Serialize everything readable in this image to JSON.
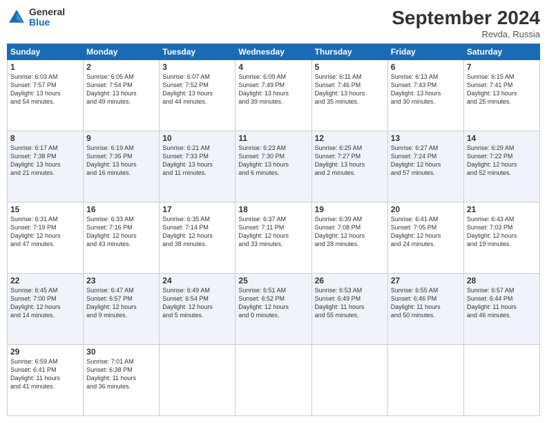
{
  "header": {
    "logo_general": "General",
    "logo_blue": "Blue",
    "title": "September 2024",
    "location": "Revda, Russia"
  },
  "weekdays": [
    "Sunday",
    "Monday",
    "Tuesday",
    "Wednesday",
    "Thursday",
    "Friday",
    "Saturday"
  ],
  "weeks": [
    [
      {
        "day": "1",
        "lines": [
          "Sunrise: 6:03 AM",
          "Sunset: 7:57 PM",
          "Daylight: 13 hours",
          "and 54 minutes."
        ]
      },
      {
        "day": "2",
        "lines": [
          "Sunrise: 6:05 AM",
          "Sunset: 7:54 PM",
          "Daylight: 13 hours",
          "and 49 minutes."
        ]
      },
      {
        "day": "3",
        "lines": [
          "Sunrise: 6:07 AM",
          "Sunset: 7:52 PM",
          "Daylight: 13 hours",
          "and 44 minutes."
        ]
      },
      {
        "day": "4",
        "lines": [
          "Sunrise: 6:09 AM",
          "Sunset: 7:49 PM",
          "Daylight: 13 hours",
          "and 39 minutes."
        ]
      },
      {
        "day": "5",
        "lines": [
          "Sunrise: 6:11 AM",
          "Sunset: 7:46 PM",
          "Daylight: 13 hours",
          "and 35 minutes."
        ]
      },
      {
        "day": "6",
        "lines": [
          "Sunrise: 6:13 AM",
          "Sunset: 7:43 PM",
          "Daylight: 13 hours",
          "and 30 minutes."
        ]
      },
      {
        "day": "7",
        "lines": [
          "Sunrise: 6:15 AM",
          "Sunset: 7:41 PM",
          "Daylight: 13 hours",
          "and 25 minutes."
        ]
      }
    ],
    [
      {
        "day": "8",
        "lines": [
          "Sunrise: 6:17 AM",
          "Sunset: 7:38 PM",
          "Daylight: 13 hours",
          "and 21 minutes."
        ]
      },
      {
        "day": "9",
        "lines": [
          "Sunrise: 6:19 AM",
          "Sunset: 7:35 PM",
          "Daylight: 13 hours",
          "and 16 minutes."
        ]
      },
      {
        "day": "10",
        "lines": [
          "Sunrise: 6:21 AM",
          "Sunset: 7:33 PM",
          "Daylight: 13 hours",
          "and 11 minutes."
        ]
      },
      {
        "day": "11",
        "lines": [
          "Sunrise: 6:23 AM",
          "Sunset: 7:30 PM",
          "Daylight: 13 hours",
          "and 6 minutes."
        ]
      },
      {
        "day": "12",
        "lines": [
          "Sunrise: 6:25 AM",
          "Sunset: 7:27 PM",
          "Daylight: 13 hours",
          "and 2 minutes."
        ]
      },
      {
        "day": "13",
        "lines": [
          "Sunrise: 6:27 AM",
          "Sunset: 7:24 PM",
          "Daylight: 12 hours",
          "and 57 minutes."
        ]
      },
      {
        "day": "14",
        "lines": [
          "Sunrise: 6:29 AM",
          "Sunset: 7:22 PM",
          "Daylight: 12 hours",
          "and 52 minutes."
        ]
      }
    ],
    [
      {
        "day": "15",
        "lines": [
          "Sunrise: 6:31 AM",
          "Sunset: 7:19 PM",
          "Daylight: 12 hours",
          "and 47 minutes."
        ]
      },
      {
        "day": "16",
        "lines": [
          "Sunrise: 6:33 AM",
          "Sunset: 7:16 PM",
          "Daylight: 12 hours",
          "and 43 minutes."
        ]
      },
      {
        "day": "17",
        "lines": [
          "Sunrise: 6:35 AM",
          "Sunset: 7:14 PM",
          "Daylight: 12 hours",
          "and 38 minutes."
        ]
      },
      {
        "day": "18",
        "lines": [
          "Sunrise: 6:37 AM",
          "Sunset: 7:11 PM",
          "Daylight: 12 hours",
          "and 33 minutes."
        ]
      },
      {
        "day": "19",
        "lines": [
          "Sunrise: 6:39 AM",
          "Sunset: 7:08 PM",
          "Daylight: 12 hours",
          "and 28 minutes."
        ]
      },
      {
        "day": "20",
        "lines": [
          "Sunrise: 6:41 AM",
          "Sunset: 7:05 PM",
          "Daylight: 12 hours",
          "and 24 minutes."
        ]
      },
      {
        "day": "21",
        "lines": [
          "Sunrise: 6:43 AM",
          "Sunset: 7:03 PM",
          "Daylight: 12 hours",
          "and 19 minutes."
        ]
      }
    ],
    [
      {
        "day": "22",
        "lines": [
          "Sunrise: 6:45 AM",
          "Sunset: 7:00 PM",
          "Daylight: 12 hours",
          "and 14 minutes."
        ]
      },
      {
        "day": "23",
        "lines": [
          "Sunrise: 6:47 AM",
          "Sunset: 6:57 PM",
          "Daylight: 12 hours",
          "and 9 minutes."
        ]
      },
      {
        "day": "24",
        "lines": [
          "Sunrise: 6:49 AM",
          "Sunset: 6:54 PM",
          "Daylight: 12 hours",
          "and 5 minutes."
        ]
      },
      {
        "day": "25",
        "lines": [
          "Sunrise: 6:51 AM",
          "Sunset: 6:52 PM",
          "Daylight: 12 hours",
          "and 0 minutes."
        ]
      },
      {
        "day": "26",
        "lines": [
          "Sunrise: 6:53 AM",
          "Sunset: 6:49 PM",
          "Daylight: 11 hours",
          "and 55 minutes."
        ]
      },
      {
        "day": "27",
        "lines": [
          "Sunrise: 6:55 AM",
          "Sunset: 6:46 PM",
          "Daylight: 11 hours",
          "and 50 minutes."
        ]
      },
      {
        "day": "28",
        "lines": [
          "Sunrise: 6:57 AM",
          "Sunset: 6:44 PM",
          "Daylight: 11 hours",
          "and 46 minutes."
        ]
      }
    ],
    [
      {
        "day": "29",
        "lines": [
          "Sunrise: 6:59 AM",
          "Sunset: 6:41 PM",
          "Daylight: 11 hours",
          "and 41 minutes."
        ]
      },
      {
        "day": "30",
        "lines": [
          "Sunrise: 7:01 AM",
          "Sunset: 6:38 PM",
          "Daylight: 11 hours",
          "and 36 minutes."
        ]
      },
      null,
      null,
      null,
      null,
      null
    ]
  ]
}
